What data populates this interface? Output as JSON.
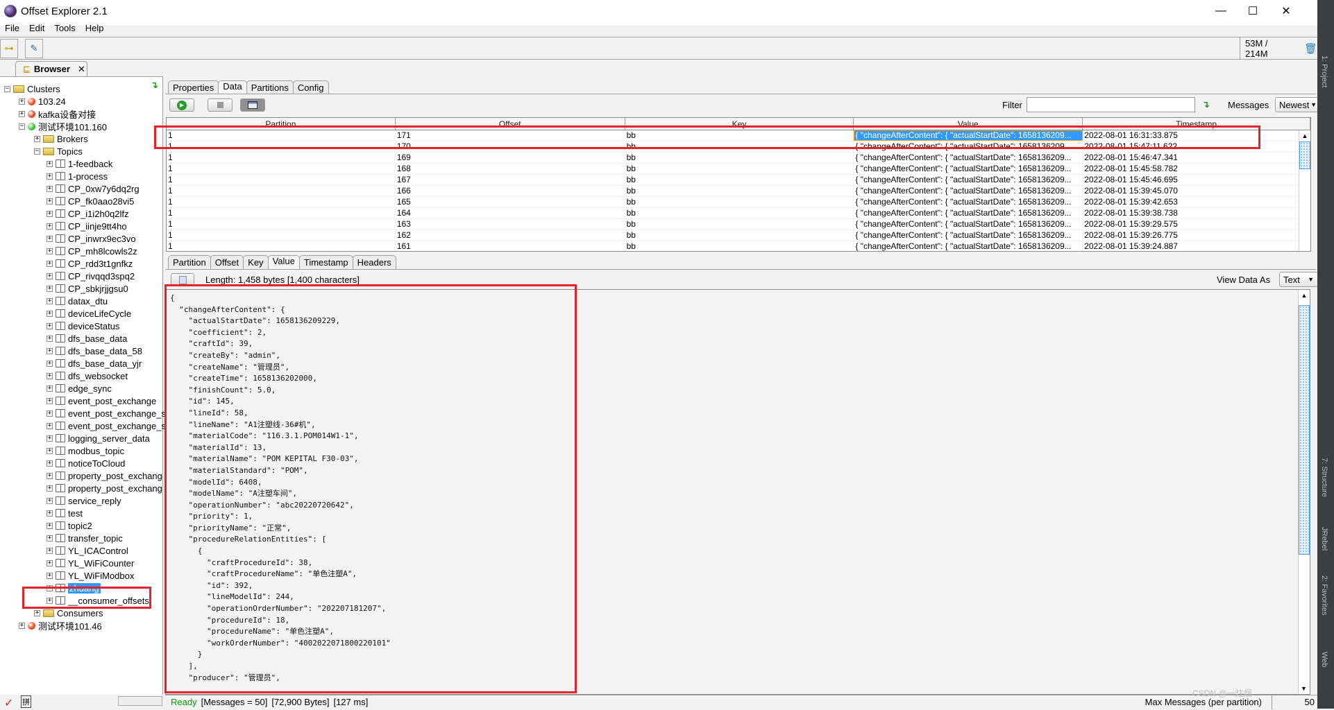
{
  "window": {
    "title": "Offset Explorer  2.1",
    "minimize": "—",
    "maximize": "☐",
    "close": "✕"
  },
  "menu": [
    "File",
    "Edit",
    "Tools",
    "Help"
  ],
  "toolbar": {
    "memory": "53M / 214M",
    "trash_icon": "trash-icon"
  },
  "browser_tab": {
    "label": "Browser",
    "close": "✕"
  },
  "tree": [
    {
      "label": "Clusters",
      "level": 0,
      "icon": "folder-open",
      "expanded": true
    },
    {
      "label": "103.24",
      "level": 1,
      "icon": "status-red",
      "expanded": false
    },
    {
      "label": "kafka设备对接",
      "level": 1,
      "icon": "status-red",
      "expanded": false
    },
    {
      "label": "测试环境101.160",
      "level": 1,
      "icon": "status-green",
      "expanded": true
    },
    {
      "label": "Brokers",
      "level": 2,
      "icon": "folder",
      "expanded": false
    },
    {
      "label": "Topics",
      "level": 2,
      "icon": "folder-open",
      "expanded": true
    },
    {
      "label": "1-feedback",
      "level": 3,
      "icon": "topic"
    },
    {
      "label": "1-process",
      "level": 3,
      "icon": "topic"
    },
    {
      "label": "CP_0xw7y6dq2rg",
      "level": 3,
      "icon": "topic"
    },
    {
      "label": "CP_fk0aao28vi5",
      "level": 3,
      "icon": "topic"
    },
    {
      "label": "CP_i1i2h0q2lfz",
      "level": 3,
      "icon": "topic"
    },
    {
      "label": "CP_iinje9tt4ho",
      "level": 3,
      "icon": "topic"
    },
    {
      "label": "CP_inwrx9ec3vo",
      "level": 3,
      "icon": "topic"
    },
    {
      "label": "CP_mh8lcowls2z",
      "level": 3,
      "icon": "topic"
    },
    {
      "label": "CP_rdd3t1gnfkz",
      "level": 3,
      "icon": "topic"
    },
    {
      "label": "CP_rivqqd3spq2",
      "level": 3,
      "icon": "topic"
    },
    {
      "label": "CP_sbkjrjjgsu0",
      "level": 3,
      "icon": "topic"
    },
    {
      "label": "datax_dtu",
      "level": 3,
      "icon": "topic"
    },
    {
      "label": "deviceLifeCycle",
      "level": 3,
      "icon": "topic"
    },
    {
      "label": "deviceStatus",
      "level": 3,
      "icon": "topic"
    },
    {
      "label": "dfs_base_data",
      "level": 3,
      "icon": "topic"
    },
    {
      "label": "dfs_base_data_58",
      "level": 3,
      "icon": "topic"
    },
    {
      "label": "dfs_base_data_yjr",
      "level": 3,
      "icon": "topic"
    },
    {
      "label": "dfs_websocket",
      "level": 3,
      "icon": "topic"
    },
    {
      "label": "edge_sync",
      "level": 3,
      "icon": "topic"
    },
    {
      "label": "event_post_exchange",
      "level": 3,
      "icon": "topic"
    },
    {
      "label": "event_post_exchange_s",
      "level": 3,
      "icon": "topic"
    },
    {
      "label": "event_post_exchange_s",
      "level": 3,
      "icon": "topic"
    },
    {
      "label": "logging_server_data",
      "level": 3,
      "icon": "topic"
    },
    {
      "label": "modbus_topic",
      "level": 3,
      "icon": "topic"
    },
    {
      "label": "noticeToCloud",
      "level": 3,
      "icon": "topic"
    },
    {
      "label": "property_post_exchang",
      "level": 3,
      "icon": "topic"
    },
    {
      "label": "property_post_exchang",
      "level": 3,
      "icon": "topic"
    },
    {
      "label": "service_reply",
      "level": 3,
      "icon": "topic"
    },
    {
      "label": "test",
      "level": 3,
      "icon": "topic"
    },
    {
      "label": "topic2",
      "level": 3,
      "icon": "topic"
    },
    {
      "label": "transfer_topic",
      "level": 3,
      "icon": "topic"
    },
    {
      "label": "YL_ICAControl",
      "level": 3,
      "icon": "topic"
    },
    {
      "label": "YL_WiFiCounter",
      "level": 3,
      "icon": "topic"
    },
    {
      "label": "YL_WiFiModbox",
      "level": 3,
      "icon": "topic"
    },
    {
      "label": "zhuang",
      "level": 3,
      "icon": "topic",
      "selected": true
    },
    {
      "label": "__consumer_offsets",
      "level": 3,
      "icon": "topic"
    },
    {
      "label": "Consumers",
      "level": 2,
      "icon": "folder",
      "expanded": false
    },
    {
      "label": "测试环境101.46",
      "level": 1,
      "icon": "status-red",
      "expanded": false
    }
  ],
  "top_tabs": [
    "Properties",
    "Data",
    "Partitions",
    "Config"
  ],
  "top_tab_active": 1,
  "data_toolbar": {
    "filter_label": "Filter",
    "filter_value": "",
    "messages_label": "Messages",
    "messages_option": "Newest"
  },
  "table": {
    "columns": [
      "Partition",
      "Offset",
      "Key",
      "Value",
      "Timestamp"
    ],
    "rows": [
      [
        "1",
        "171",
        "bb",
        "{  \"changeAfterContent\": {    \"actualStartDate\": 1658136209...",
        "2022-08-01 16:31:33.875"
      ],
      [
        "1",
        "170",
        "bb",
        "{  \"changeAfterContent\": {    \"actualStartDate\": 1658136209...",
        "2022-08-01 15:47:11.622"
      ],
      [
        "1",
        "169",
        "bb",
        "{  \"changeAfterContent\": {    \"actualStartDate\": 1658136209...",
        "2022-08-01 15:46:47.341"
      ],
      [
        "1",
        "168",
        "bb",
        "{  \"changeAfterContent\": {    \"actualStartDate\": 1658136209...",
        "2022-08-01 15:45:58.782"
      ],
      [
        "1",
        "167",
        "bb",
        "{  \"changeAfterContent\": {    \"actualStartDate\": 1658136209...",
        "2022-08-01 15:45:46.695"
      ],
      [
        "1",
        "166",
        "bb",
        "{  \"changeAfterContent\": {    \"actualStartDate\": 1658136209...",
        "2022-08-01 15:39:45.070"
      ],
      [
        "1",
        "165",
        "bb",
        "{  \"changeAfterContent\": {    \"actualStartDate\": 1658136209...",
        "2022-08-01 15:39:42.653"
      ],
      [
        "1",
        "164",
        "bb",
        "{  \"changeAfterContent\": {    \"actualStartDate\": 1658136209...",
        "2022-08-01 15:39:38.738"
      ],
      [
        "1",
        "163",
        "bb",
        "{  \"changeAfterContent\": {    \"actualStartDate\": 1658136209...",
        "2022-08-01 15:39:29.575"
      ],
      [
        "1",
        "162",
        "bb",
        "{  \"changeAfterContent\": {    \"actualStartDate\": 1658136209...",
        "2022-08-01 15:39:26.775"
      ],
      [
        "1",
        "161",
        "bb",
        "{  \"changeAfterContent\": {    \"actualStartDate\": 1658136209...",
        "2022-08-01 15:39:24.887"
      ]
    ],
    "selected_row": 0
  },
  "detail_tabs": [
    "Partition",
    "Offset",
    "Key",
    "Value",
    "Timestamp",
    "Headers"
  ],
  "detail_tab_active": 3,
  "detail": {
    "length": "Length: 1,458 bytes [1,400 characters]",
    "view_label": "View Data As",
    "view_option": "Text"
  },
  "value_lines": [
    "{",
    "  \"changeAfterContent\": {",
    "    \"actualStartDate\": 1658136209229,",
    "    \"coefficient\": 2,",
    "    \"craftId\": 39,",
    "    \"createBy\": \"admin\",",
    "    \"createName\": \"管理员\",",
    "    \"createTime\": 1658136202000,",
    "    \"finishCount\": 5.0,",
    "    \"id\": 145,",
    "    \"lineId\": 58,",
    "    \"lineName\": \"A1注塑线-36#机\",",
    "    \"materialCode\": \"116.3.1.POM014W1-1\",",
    "    \"materialId\": 13,",
    "    \"materialName\": \"POM KEPITAL F30-03\",",
    "    \"materialStandard\": \"POM\",",
    "    \"modelId\": 6408,",
    "    \"modelName\": \"A注塑车间\",",
    "    \"operationNumber\": \"abc20220720642\",",
    "    \"priority\": 1,",
    "    \"priorityName\": \"正常\",",
    "    \"procedureRelationEntities\": [",
    "      {",
    "        \"craftProcedureId\": 38,",
    "        \"craftProcedureName\": \"单色注塑A\",",
    "        \"id\": 392,",
    "        \"lineModelId\": 244,",
    "        \"operationOrderNumber\": \"202207181207\",",
    "        \"procedureId\": 18,",
    "        \"procedureName\": \"单色注塑A\",",
    "        \"workOrderNumber\": \"4002022071800220101\"",
    "      }",
    "    ],",
    "    \"producer\": \"管理员\","
  ],
  "status": {
    "ready": "Ready",
    "messages": "[Messages = 50]",
    "bytes": "[72,900 Bytes]",
    "time": "[127 ms]",
    "max_label": "Max Messages (per partition)",
    "max_value": "50",
    "watermark": "CSDN @一炷烟"
  },
  "ide_strip": [
    "1: Project",
    "7: Structure",
    "JRebel",
    "2: Favorites",
    "Web"
  ],
  "colors": {
    "selection": "#3399ff",
    "annotation": "#e8202a",
    "ready": "#00a000",
    "status_red": "#e84020",
    "status_green": "#30c030"
  }
}
